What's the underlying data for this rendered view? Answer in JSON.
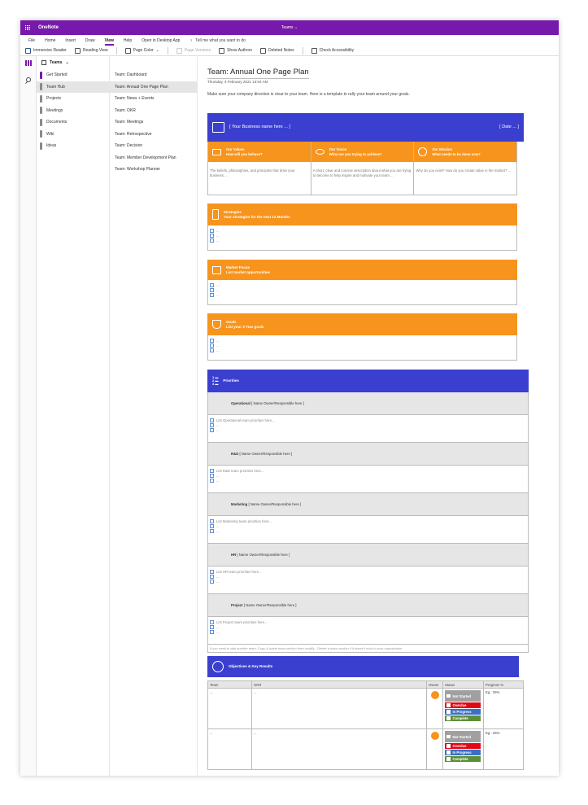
{
  "app": {
    "name": "OneNote",
    "notebook": "Teams"
  },
  "menu": [
    "File",
    "Home",
    "Insert",
    "Draw",
    "View",
    "Help",
    "Open in Desktop App"
  ],
  "active_menu": "View",
  "tell_me": "Tell me what you want to do",
  "toolbar": {
    "immersive": "Immersive Reader",
    "reading": "Reading View",
    "page_color": "Page Color",
    "page_versions": "Page Versions",
    "show_authors": "Show Authors",
    "deleted_notes": "Deleted Notes",
    "check_access": "Check Accessibility"
  },
  "notebook_header": "Teams",
  "sections": [
    "Get Started",
    "Team Hub",
    "Projects",
    "Meetings",
    "Documents",
    "Wiki",
    "Ideas"
  ],
  "section_colors": [
    "#7719aa",
    "#8a8a8a",
    "#8a8a8a",
    "#8a8a8a",
    "#8a8a8a",
    "#8a8a8a",
    "#8a8a8a"
  ],
  "pages": [
    "Team: Dashboard",
    "Team: Annual One Page Plan",
    "Team: News + Events",
    "Team: OKR",
    "Team: Meetings",
    "Team: Retrospective",
    "Team: Decision",
    "Team: Member Development Plan",
    "Team: Workshop Planner"
  ],
  "page": {
    "title": "Team: Annual One Page Plan",
    "date": "Thursday, 4 February 2021   13:04 AM",
    "intro": "Make sure your company direction is clear to your team. Here is a template to rally your team around your goals."
  },
  "business": {
    "name": "[ Your Business name here ... ]",
    "date": "[ Date ... ]"
  },
  "vmm": [
    {
      "title": "Our Values",
      "sub": "How will you behave?",
      "body": "The beliefs, philosophies, and principles that drive your business ..."
    },
    {
      "title": "Our Vision",
      "sub": "What are you trying to achieve?",
      "body": "A short, clear and concise description about what you are trying to become to help inspire and motivate your team ..."
    },
    {
      "title": "Our Mission",
      "sub": "What needs to be done now?",
      "body": "Why do you exist? How do you create value in the market? ..."
    }
  ],
  "strategies": {
    "title": "Strategies",
    "sub": "Your strategies for the next 12 Months"
  },
  "market": {
    "title": "Market Focus",
    "sub": "List market opportunities"
  },
  "goals": {
    "title": "Goals",
    "sub": "List your 3 Year goals"
  },
  "placeholder": "...",
  "priorities": {
    "title": "Priorities",
    "groups": [
      {
        "name": "Operational",
        "owner": "[ Name Owner/Responsible here ]",
        "hint": "List Operational team priorities here..."
      },
      {
        "name": "R&D",
        "owner": "[ Name Owner/Responsible here ]",
        "hint": "List R&D team priorities here..."
      },
      {
        "name": "Marketing",
        "owner": "[ Name Owner/Responsible here ]",
        "hint": "List Marketing team priorities here..."
      },
      {
        "name": "HR",
        "owner": "[ Name Owner/Responsible here ]",
        "hint": "List HR team priorities here..."
      },
      {
        "name": "Project",
        "owner": "[ Name Owner/Responsible here ]",
        "hint": "List Project team priorities here..."
      }
    ],
    "footer": "If you need to add another team: Copy & paste team section then modify - Delete a team section if it doesn't exist in your organization"
  },
  "okr": {
    "title": "Objectives & Key Results",
    "headers": [
      "Team",
      "OKR",
      "Owner",
      "Status",
      "Progress %"
    ],
    "rows": [
      {
        "team": "...",
        "okr": "...",
        "progress": "Eg.: 25%"
      },
      {
        "team": "...",
        "okr": "...",
        "progress": "Eg.: 25%"
      }
    ],
    "statuses": [
      "Not Started",
      "Overdue",
      "In Progress",
      "Complete"
    ]
  }
}
